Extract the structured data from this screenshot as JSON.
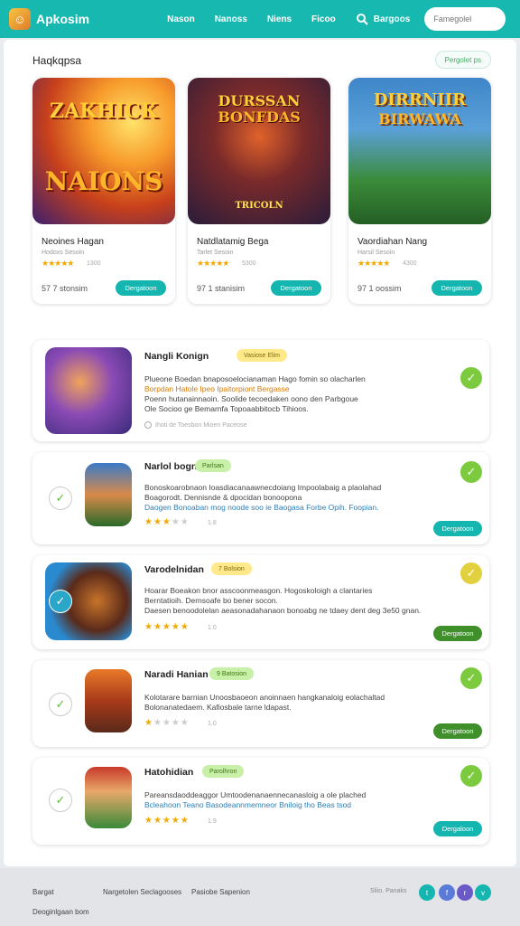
{
  "topbar": {
    "brand": "Apkosim",
    "nav": [
      "Nason",
      "Nanoss",
      "Niens",
      "Ficoo"
    ],
    "account": "Bargoos",
    "search_placeholder": "Famegolel"
  },
  "featured": {
    "title": "Haqkqpsa",
    "view_all": "Pergolet ps",
    "cards": [
      {
        "art_text_1": "ZAKHICK",
        "art_text_2": "NAIONS",
        "name": "Neoines Hagan",
        "dev": "Hodoxs Sesoin",
        "stars": "★★★★★",
        "rating": "1300",
        "size": "57 7 stonsim",
        "button": "Dergatoon"
      },
      {
        "art_text_1": "DURSSAN",
        "art_text_2": "BONFDAS",
        "art_text_3": "TRICOLN",
        "name": "Natdlatamig Bega",
        "dev": "Tarlet Sesoin",
        "stars": "★★★★★",
        "rating": "5300",
        "size": "97 1 stanisim",
        "button": "Dergatoon"
      },
      {
        "art_text_1": "DIRRNIIR",
        "art_text_2": "BIRWAWA",
        "name": "Vaordiahan Nang",
        "dev": "Harsil Sesoin",
        "stars": "★★★★★",
        "rating": "4300",
        "size": "97 1 oossim",
        "button": "Dergatoon"
      }
    ]
  },
  "list": [
    {
      "title": "Nangli Konign",
      "badge": "Vasiose Elim",
      "desc1": "Plueone Boedan bnaposoelocianaman Hago fomin so olacharlen",
      "desc2": "Borpdan Hatole Ipeo Ipaitorpiont Bergasse",
      "desc3": "Poenn hutanainnaoin. Soolide tecoedaken oono den Parbgoue",
      "desc4": "Ole Socioo ge Bemarnfa Topoaabbitocb Tihioos.",
      "rating_text": "Ihoti de Toesbon Mioen Paceose",
      "stars_on": 0,
      "stars_off": 0,
      "count": "",
      "button": ""
    },
    {
      "title": "Narlol bogn",
      "badge": "Parlsan",
      "desc1": "Bonoskoarobnaon Ioasdiacanaawnecdoiang Impoolabaig a plaolahad",
      "desc2": "Boagorodt. Dennisnde & dpocidan bonoopona",
      "desc3": "Daogen Bonoaban mog noode soo ie Baogasa Forbe Opih. Foopian.",
      "desc4": "",
      "rating_text": "",
      "stars_on": 3,
      "stars_off": 2,
      "count": "1.8",
      "button": "Dergatoon"
    },
    {
      "title": "Varodelnidan",
      "badge": "7 Bolsion",
      "desc1": "Hoarar Boeakon bnor asscoonmeasgon. Hogoskoloigh a clantaries",
      "desc2": "Berntatioih. Dernsoafe bo bener socon.",
      "desc3": "Daesen benoodolelan aeasonadahanaon bonoabg ne tdaey dent deg 3e50 gnan.",
      "desc4": "",
      "rating_text": "",
      "stars_on": 5,
      "stars_off": 0,
      "count": "1.0",
      "button": "Dergatoon"
    },
    {
      "title": "Naradi Hanian",
      "badge": "9 Batosion",
      "desc1": "Kolotarare barnian Unoosbaoeon anoinnaen hangkanaloig eolachaltad",
      "desc2": "Bolonanatedaem. Kafiosbale tarne ldapast.",
      "desc3": "",
      "desc4": "",
      "rating_text": "",
      "stars_on": 1,
      "stars_off": 4,
      "count": "1.0",
      "button": "Dergatoon"
    },
    {
      "title": "Hatohidian",
      "badge": "Parolhron",
      "desc1": "Pareansdaoddeaggor Umtoodenanaennecanasloig a ole plached",
      "desc2": "Bcleahoon Teano Basodeannmemneor Bniloig tho Beas tsod",
      "desc3": "",
      "desc4": "",
      "rating_text": "",
      "stars_on": 5,
      "stars_off": 0,
      "count": "1.9",
      "button": "Dergaloon"
    }
  ],
  "footer": {
    "links": [
      "Bargat",
      "Nargetolen Seclagooses",
      "Pasiobe Sapenion",
      "Deoginlgaan bom"
    ],
    "social_label": "Sliio. Panaks"
  },
  "colors": {
    "teal": "#16b8b0",
    "green_button": "#3f8f2a",
    "check_green": "#7ccb3e",
    "check_yellow": "#e2d13e"
  }
}
